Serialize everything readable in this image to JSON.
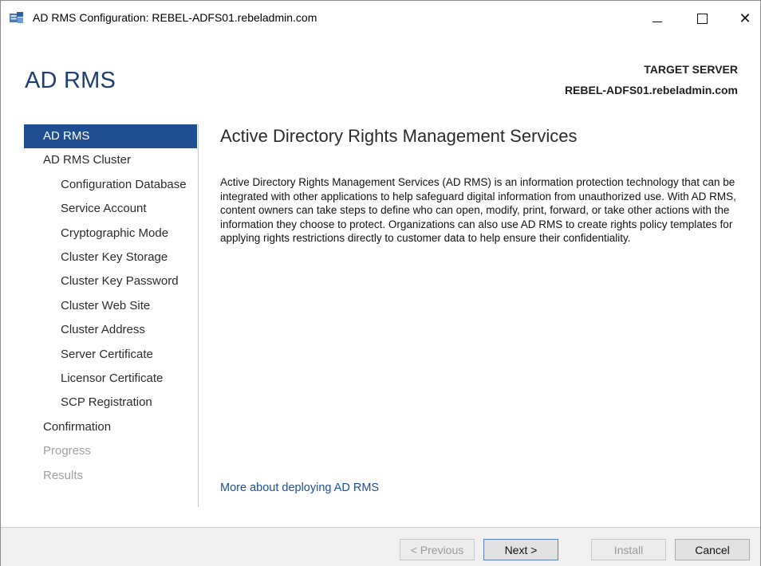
{
  "window": {
    "title": "AD RMS Configuration: REBEL-ADFS01.rebeladmin.com",
    "icon": "server-role-icon",
    "controls": {
      "minimize": "minimize-icon",
      "maximize": "maximize-icon",
      "close": "✕"
    }
  },
  "header": {
    "title": "AD RMS",
    "target_label": "TARGET SERVER",
    "target_value": "REBEL-ADFS01.rebeladmin.com"
  },
  "nav": {
    "items": [
      {
        "label": "AD RMS",
        "level": 1,
        "state": "active"
      },
      {
        "label": "AD RMS Cluster",
        "level": 1,
        "state": "normal"
      },
      {
        "label": "Configuration Database",
        "level": 2,
        "state": "normal"
      },
      {
        "label": "Service Account",
        "level": 2,
        "state": "normal"
      },
      {
        "label": "Cryptographic Mode",
        "level": 2,
        "state": "normal"
      },
      {
        "label": "Cluster Key Storage",
        "level": 2,
        "state": "normal"
      },
      {
        "label": "Cluster Key Password",
        "level": 2,
        "state": "normal"
      },
      {
        "label": "Cluster Web Site",
        "level": 2,
        "state": "normal"
      },
      {
        "label": "Cluster Address",
        "level": 2,
        "state": "normal"
      },
      {
        "label": "Server Certificate",
        "level": 2,
        "state": "normal"
      },
      {
        "label": "Licensor Certificate",
        "level": 2,
        "state": "normal"
      },
      {
        "label": "SCP Registration",
        "level": 2,
        "state": "normal"
      },
      {
        "label": "Confirmation",
        "level": 1,
        "state": "normal"
      },
      {
        "label": "Progress",
        "level": 1,
        "state": "disabled"
      },
      {
        "label": "Results",
        "level": 1,
        "state": "disabled"
      }
    ]
  },
  "content": {
    "heading": "Active Directory Rights Management Services",
    "body": "Active Directory Rights Management Services (AD RMS) is an information protection technology that can be integrated with other applications to help safeguard digital information from unauthorized use. With AD RMS, content owners can take steps to define who can open, modify, print, forward, or take other actions with the information they choose to protect. Organizations can also use AD RMS to create rights policy templates for applying rights restrictions directly to customer data to help ensure their confidentiality.",
    "more_link": "More about deploying AD RMS"
  },
  "footer": {
    "previous": "< Previous",
    "next": "Next >",
    "install": "Install",
    "cancel": "Cancel"
  },
  "colors": {
    "accent": "#1f4e93",
    "title": "#1f3e6e",
    "link": "#1b4f9c",
    "disabled": "#a0a0a0"
  }
}
